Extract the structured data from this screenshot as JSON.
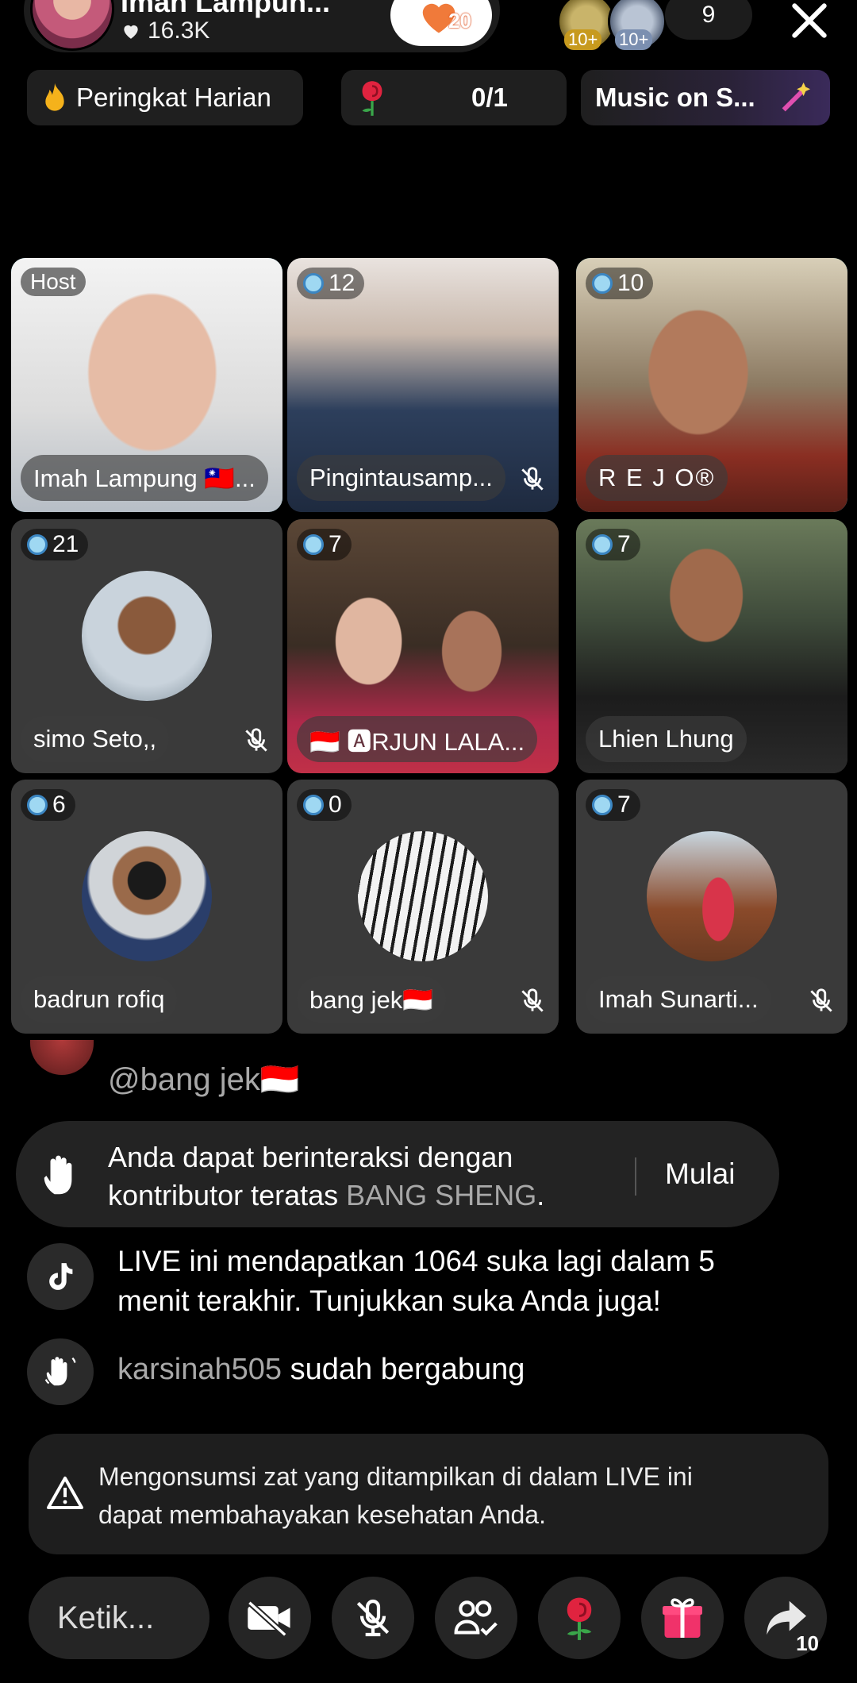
{
  "header": {
    "host_name": "Imah Lampun...",
    "host_likes": "16.3K",
    "follow_badge": "20",
    "viewer_badges": [
      "10+",
      "10+"
    ],
    "viewer_count": "9"
  },
  "chips": {
    "ranking": "Peringkat Harian",
    "rose_goal": "0/1",
    "music": "Music on S..."
  },
  "tiles": [
    {
      "tag": "Host",
      "name": "Imah Lampung 🇹🇼..."
    },
    {
      "count": "12",
      "name": "Pingintausamp..."
    },
    {
      "count": "10",
      "name": "R E J O®"
    },
    {
      "count": "21",
      "name": "simo Seto,,"
    },
    {
      "count": "7",
      "name": "🇮🇩 🅰RJUN LALA..."
    },
    {
      "count": "7",
      "name": "Lhien Lhung"
    },
    {
      "count": "6",
      "name": "badrun rofiq"
    },
    {
      "count": "0",
      "name": "bang jek🇮🇩"
    },
    {
      "count": "7",
      "name": "Imah Sunarti..."
    }
  ],
  "comments": {
    "mention": "@bang jek🇮🇩",
    "interact_text_1": "Anda dapat berinteraksi dengan",
    "interact_text_2": "kontributor teratas ",
    "interact_user": "BANG SHENG",
    "interact_period": ".",
    "interact_button": "Mulai",
    "live_line_1": "LIVE ini mendapatkan 1064 suka lagi dalam 5",
    "live_line_2": "menit terakhir. Tunjukkan suka Anda juga!",
    "joined_user": "karsinah505",
    "joined_text": " sudah bergabung",
    "warning_line_1": "Mengonsumsi zat yang ditampilkan di dalam LIVE ini",
    "warning_line_2": "dapat membahayakan kesehatan Anda."
  },
  "bottom": {
    "type_placeholder": "Ketik...",
    "share_count": "10"
  }
}
